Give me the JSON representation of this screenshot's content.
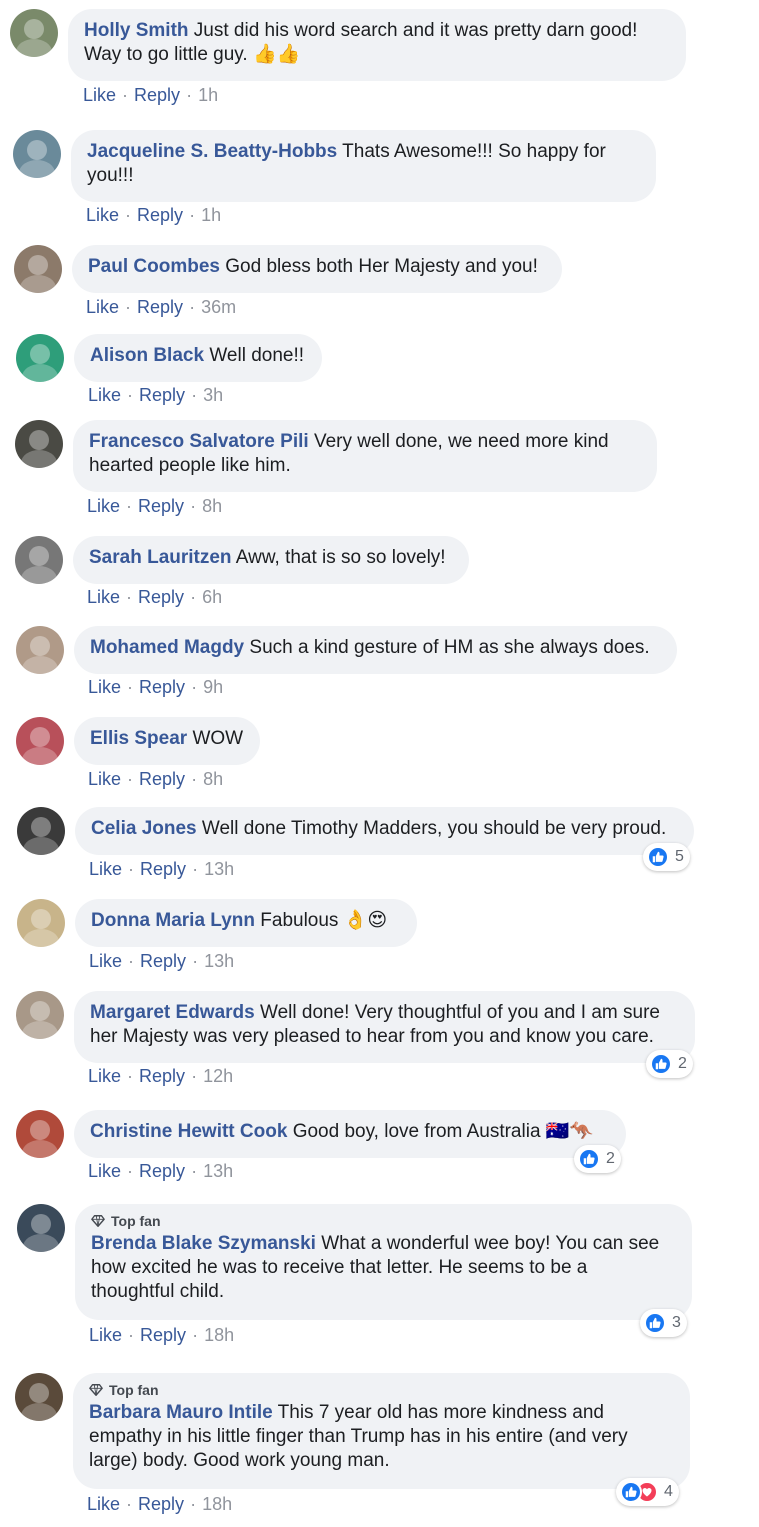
{
  "actions": {
    "like": "Like",
    "reply": "Reply",
    "sep": "·"
  },
  "comments": [
    {
      "author": "Holly Smith",
      "text": "Just did his word search and it was pretty darn good! Way to go little guy. 👍👍",
      "time": "1h",
      "avatar_color": "#7a8a6a"
    },
    {
      "author": "Jacqueline S. Beatty-Hobbs",
      "text": "Thats Awesome!!! So happy for you!!!",
      "time": "1h",
      "avatar_color": "#6a8a9a"
    },
    {
      "author": "Paul Coombes",
      "text": "God bless both Her Majesty and you!",
      "time": "36m",
      "avatar_color": "#8c7a6a"
    },
    {
      "author": "Alison Black",
      "text": "Well done!!",
      "time": "3h",
      "avatar_color": "#2e9e7a"
    },
    {
      "author": "Francesco Salvatore Pili",
      "text": "Very well done, we need more kind hearted people like him.",
      "time": "8h",
      "avatar_color": "#4a4a44"
    },
    {
      "author": "Sarah Lauritzen",
      "text": "Aww, that is so so lovely!",
      "time": "6h",
      "avatar_color": "#777777"
    },
    {
      "author": "Mohamed Magdy",
      "text": "Such a kind gesture of HM as she always does.",
      "time": "9h",
      "avatar_color": "#b09a88"
    },
    {
      "author": "Ellis Spear",
      "text": "WOW",
      "time": "8h",
      "avatar_color": "#b8505a"
    },
    {
      "author": "Celia Jones",
      "text": "Well done Timothy Madders, you should be very proud.",
      "time": "13h",
      "reactions": "5",
      "avatar_color": "#3a3a3a"
    },
    {
      "author": "Donna Maria Lynn",
      "text": "Fabulous 👌😍",
      "time": "13h",
      "avatar_color": "#c8b48a"
    },
    {
      "author": "Margaret Edwards",
      "text": "Well done! Very thoughtful of you and I am sure her Majesty was very pleased to hear from you and know you care.",
      "time": "12h",
      "reactions": "2",
      "avatar_color": "#a89888"
    },
    {
      "author": "Christine Hewitt Cook",
      "text": "Good boy, love from Australia 🇦🇺🦘",
      "time": "13h",
      "reactions": "2",
      "avatar_color": "#b04a3a"
    },
    {
      "author": "Brenda Blake Szymanski",
      "badge": "Top fan",
      "text": "What a wonderful wee boy! You can see how excited he was to receive that letter. He seems to be a thoughtful child.",
      "time": "18h",
      "reactions": "3",
      "avatar_color": "#3a4a5a"
    },
    {
      "author": "Barbara Mauro Intile",
      "badge": "Top fan",
      "text": "This 7 year old has more kindness and empathy in his little finger than Trump has in his entire (and very large) body. Good work young man.",
      "time": "18h",
      "reactions": "4",
      "avatar_color": "#5a4a3a"
    }
  ]
}
